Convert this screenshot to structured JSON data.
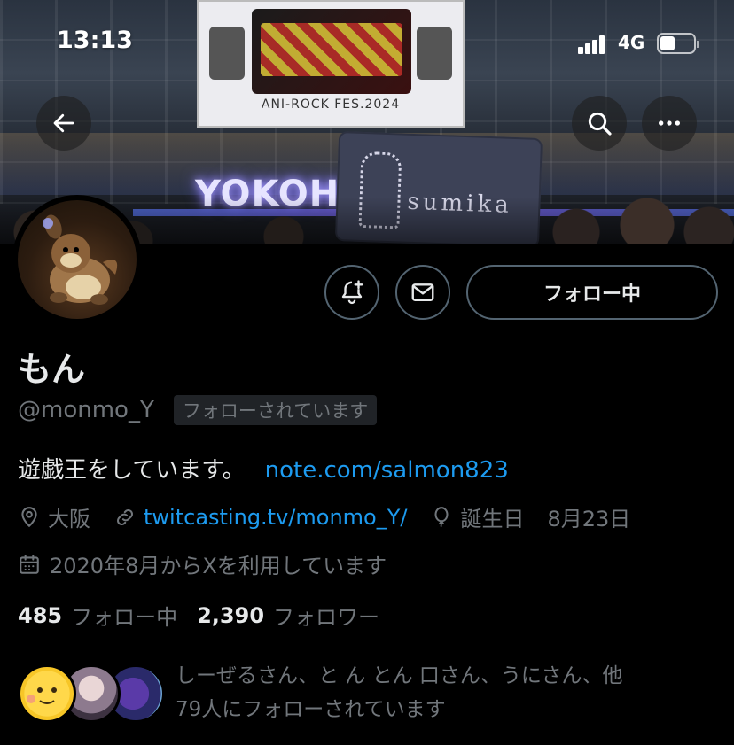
{
  "status_bar": {
    "time": "13:13",
    "network": "4G"
  },
  "banner": {
    "billboard_text": "ANI-ROCK FES.2024",
    "venue_sign": "YOKOHA",
    "card_text": "sumika"
  },
  "header": {
    "back_icon": "arrow-left-icon",
    "search_icon": "search-icon",
    "more_icon": "more-horizontal-icon"
  },
  "actions": {
    "notify_icon": "bell-plus-icon",
    "message_icon": "envelope-icon",
    "follow_label": "フォロー中"
  },
  "profile": {
    "display_name": "もん",
    "handle": "@monmo_Y",
    "follows_you": "フォローされています",
    "bio_text": "遊戯王をしています。",
    "bio_link": "note.com/salmon823",
    "location": "大阪",
    "website": "twitcasting.tv/monmo_Y/",
    "birthday_label": "誕生日",
    "birthday_value": "8月23日",
    "joined": "2020年8月からXを利用しています"
  },
  "stats": {
    "following_count": "485",
    "following_label": "フォロー中",
    "followers_count": "2,390",
    "followers_label": "フォロワー"
  },
  "followed_by": {
    "line1": "しーぜるさん、と ん とん 口さん、うにさん、他",
    "line2": "79人にフォローされています"
  },
  "colors": {
    "background": "#000000",
    "text_primary": "#e7e9ea",
    "text_secondary": "#71767b",
    "link": "#1d9bf0",
    "border": "#536471"
  }
}
